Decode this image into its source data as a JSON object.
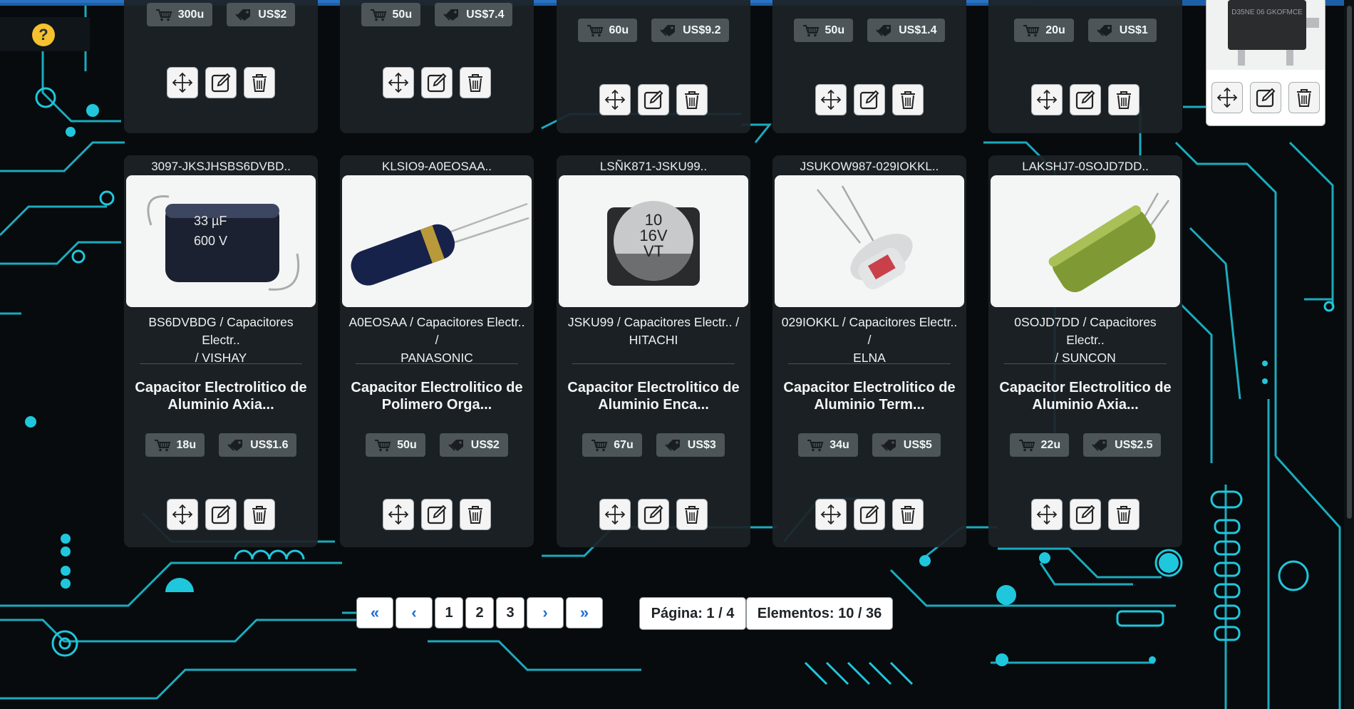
{
  "help": {
    "label": "?"
  },
  "top_row": [
    {
      "stock": "300u",
      "price": "US$2"
    },
    {
      "stock": "50u",
      "price": "US$7.4"
    },
    {
      "stock": "60u",
      "price": "US$9.2"
    },
    {
      "stock": "50u",
      "price": "US$1.4"
    },
    {
      "stock": "20u",
      "price": "US$1"
    }
  ],
  "cards": [
    {
      "code": "3097-JKSJHSBS6DVBD..",
      "subtitle_line1": "BS6DVBDG / Capacitores Electr..",
      "subtitle_line2": "/ VISHAY",
      "name_line1": "Capacitor Electrolitico de",
      "name_line2": "Aluminio Axia...",
      "stock": "18u",
      "price": "US$1.6"
    },
    {
      "code": "KLSIO9-A0EOSAA..",
      "subtitle_line1": "A0EOSAA / Capacitores Electr.. /",
      "subtitle_line2": "PANASONIC",
      "name_line1": "Capacitor Electrolitico de",
      "name_line2": "Polimero Orga...",
      "stock": "50u",
      "price": "US$2"
    },
    {
      "code": "LSÑK871-JSKU99..",
      "subtitle_line1": "JSKU99 / Capacitores Electr.. /",
      "subtitle_line2": "HITACHI",
      "name_line1": "Capacitor Electrolitico de",
      "name_line2": "Aluminio Enca...",
      "stock": "67u",
      "price": "US$3"
    },
    {
      "code": "JSUKOW987-029IOKKL..",
      "subtitle_line1": "029IOKKL / Capacitores Electr.. /",
      "subtitle_line2": "ELNA",
      "name_line1": "Capacitor Electrolitico de",
      "name_line2": "Aluminio Term...",
      "stock": "34u",
      "price": "US$5"
    },
    {
      "code": "LAKSHJ7-0SOJD7DD..",
      "subtitle_line1": "0SOJD7DD / Capacitores Electr..",
      "subtitle_line2": "/ SUNCON",
      "name_line1": "Capacitor Electrolitico de",
      "name_line2": "Aluminio Axia...",
      "stock": "22u",
      "price": "US$2.5"
    }
  ],
  "image_text": {
    "vishay_cap": [
      "33 µF",
      "600 V"
    ],
    "hitachi_cap": [
      "10",
      "16V",
      "VT"
    ],
    "mini_chip": "D35NE 06 GKOFMCE"
  },
  "pagination": {
    "pages": [
      "1",
      "2",
      "3"
    ],
    "first_icon": "«",
    "prev_icon": "‹",
    "next_icon": "›",
    "last_icon": "»",
    "page_info": "Página: 1 / 4",
    "elements_info": "Elementos: 10 / 36"
  },
  "colors": {
    "accent": "#22d6ea",
    "background": "#070b0d",
    "card": "#1c2227",
    "badge": "#4d5558",
    "nav_blue": "#1f6fd6"
  },
  "icons": {
    "stock": "cart-icon",
    "price": "price-tag-icon",
    "move": "move-icon",
    "edit": "edit-icon",
    "delete": "trash-icon",
    "help": "question-icon"
  }
}
